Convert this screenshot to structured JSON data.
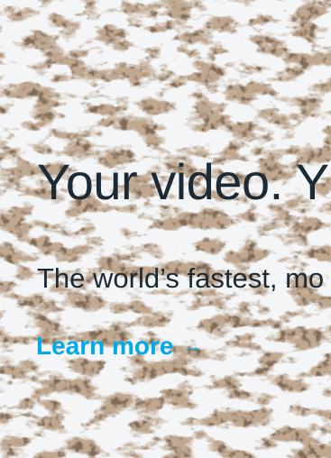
{
  "hero": {
    "headline": "Your video. Y",
    "subhead": "The world’s fastest, mo",
    "cta_label": "Learn more",
    "cta_arrow": "→"
  },
  "colors": {
    "text": "#1b2a35",
    "accent": "#00a9e8",
    "snow": "#f3f5f6",
    "rock": "#8a6548"
  },
  "icons": {
    "cta": "arrow-right-icon"
  }
}
